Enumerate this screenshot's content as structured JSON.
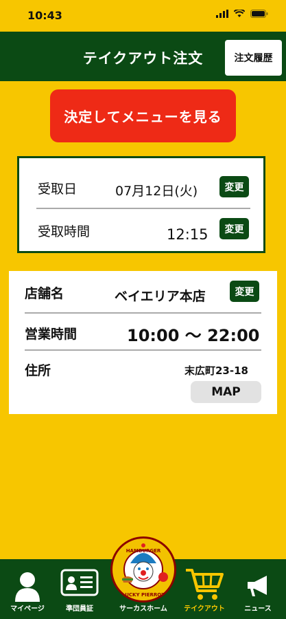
{
  "status_bar": {
    "time": "10:43"
  },
  "header": {
    "title": "テイクアウト注文",
    "history_button": "注文履歴"
  },
  "menu_button": "決定してメニューを見る",
  "pickup": {
    "date_label": "受取日",
    "date_value": "07月12日(火)",
    "time_label": "受取時間",
    "time_value": "12:15",
    "change_label": "変更"
  },
  "store": {
    "name_label": "店舗名",
    "name_value": "ベイエリア本店",
    "hours_label": "営業時間",
    "hours_value": "10:00 ～ 22:00",
    "address_label": "住所",
    "address_value": "末広町23-18",
    "map_button": "MAP",
    "change_label": "変更"
  },
  "tabbar": {
    "items": [
      {
        "label": "マイページ",
        "icon": "person-icon"
      },
      {
        "label": "準団員証",
        "icon": "id-card-icon"
      },
      {
        "label": "サーカスホーム",
        "icon": "logo-icon"
      },
      {
        "label": "テイクアウト",
        "icon": "cart-icon"
      },
      {
        "label": "ニュース",
        "icon": "megaphone-icon"
      }
    ]
  },
  "logo": {
    "top_text": "HAMBURGER",
    "bottom_text": "LUCKY PIERROT"
  },
  "colors": {
    "background": "#F7C600",
    "primary": "#0B4A14",
    "accent": "#EE2A16"
  }
}
